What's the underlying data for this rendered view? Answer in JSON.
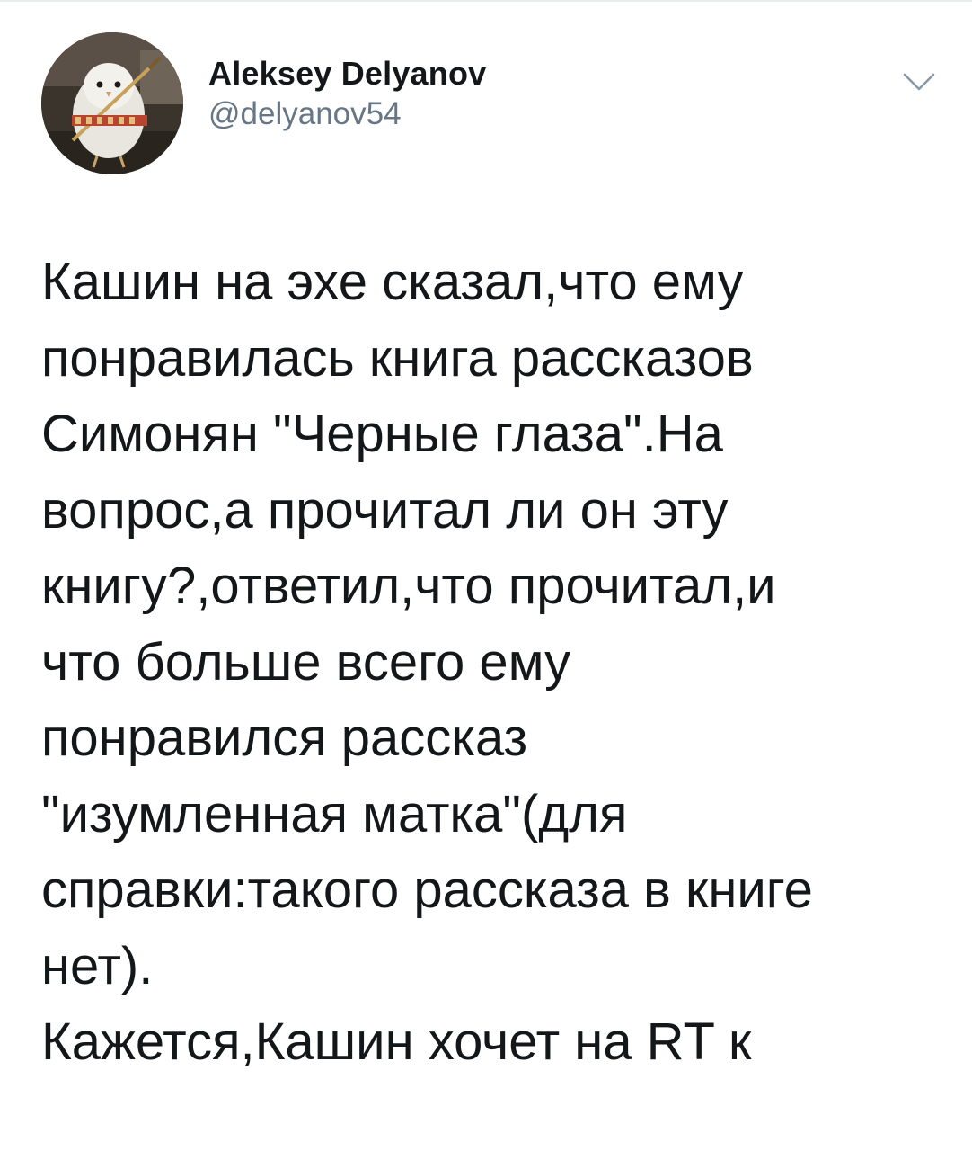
{
  "tweet": {
    "author": {
      "display_name": "Aleksey Delyanov",
      "handle": "@delyanov54",
      "avatar_icon": "owl-chick-avatar"
    },
    "menu_icon": "chevron-down-icon",
    "text": "Кашин на эхе сказал,что ему\nпонравилась книга рассказов\nСимонян \"Черные глаза\".На\nвопрос,а прочитал ли он эту\nкнигу?,ответил,что прочитал,и\nчто больше всего ему\nпонравился рассказ\n\"изумленная матка\"(для\nсправки:такого рассказа в книге\nнет).\nКажется,Кашин хочет на RT к"
  },
  "colors": {
    "text_primary": "#14171a",
    "text_secondary": "#657786",
    "divider": "#e6ecf0",
    "caret": "#8899a6",
    "background": "#ffffff"
  }
}
